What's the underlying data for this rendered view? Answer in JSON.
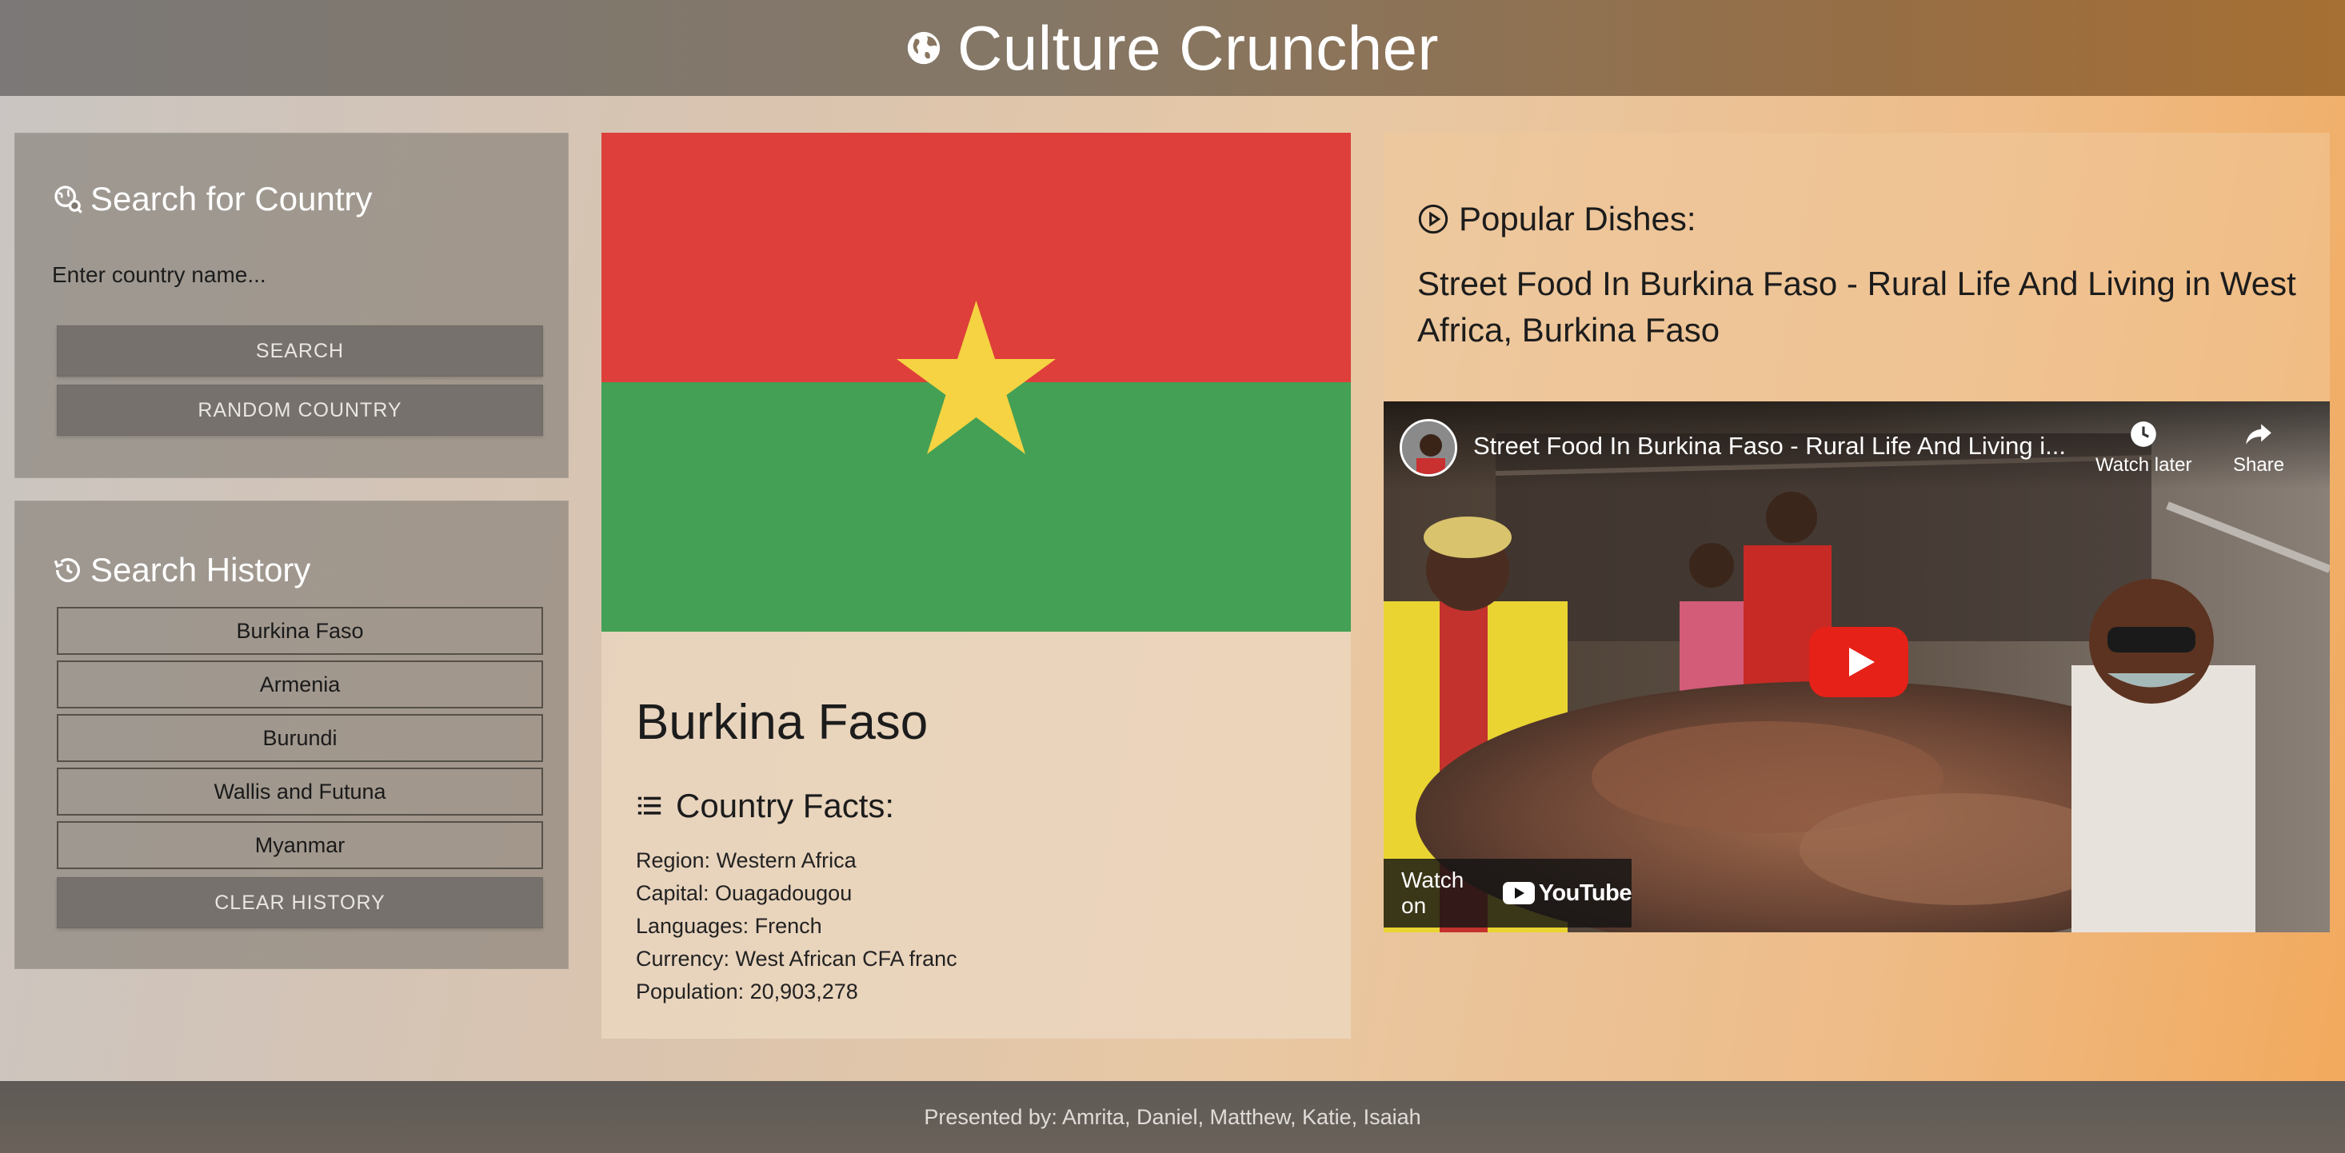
{
  "header": {
    "title": "Culture Cruncher",
    "icon": "globe-icon"
  },
  "search": {
    "title": "Search for Country",
    "icon": "search-globe-icon",
    "placeholder": "Enter country name...",
    "search_label": "SEARCH",
    "random_label": "RANDOM COUNTRY"
  },
  "history": {
    "title": "Search History",
    "icon": "history-icon",
    "items": [
      "Burkina Faso",
      "Armenia",
      "Burundi",
      "Wallis and Futuna",
      "Myanmar"
    ],
    "clear_label": "CLEAR HISTORY"
  },
  "country": {
    "name": "Burkina Faso",
    "flag_colors": {
      "red": "#de3f3a",
      "green": "#44a055",
      "star": "#f5d342"
    },
    "facts_title": "Country Facts:",
    "facts": [
      "Region: Western Africa",
      "Capital: Ouagadougou",
      "Languages: French",
      "Currency: West African CFA franc",
      "Population: 20,903,278"
    ]
  },
  "dishes": {
    "title": "Popular Dishes:",
    "description": "Street Food In Burkina Faso - Rural Life And Living in West Africa, Burkina Faso",
    "video": {
      "title": "Street Food In Burkina Faso - Rural Life And Living i...",
      "watch_later": "Watch later",
      "share": "Share",
      "watch_on": "Watch on",
      "youtube": "YouTube"
    }
  },
  "footer": {
    "text": "Presented by: Amrita, Daniel, Matthew, Katie, Isaiah"
  }
}
